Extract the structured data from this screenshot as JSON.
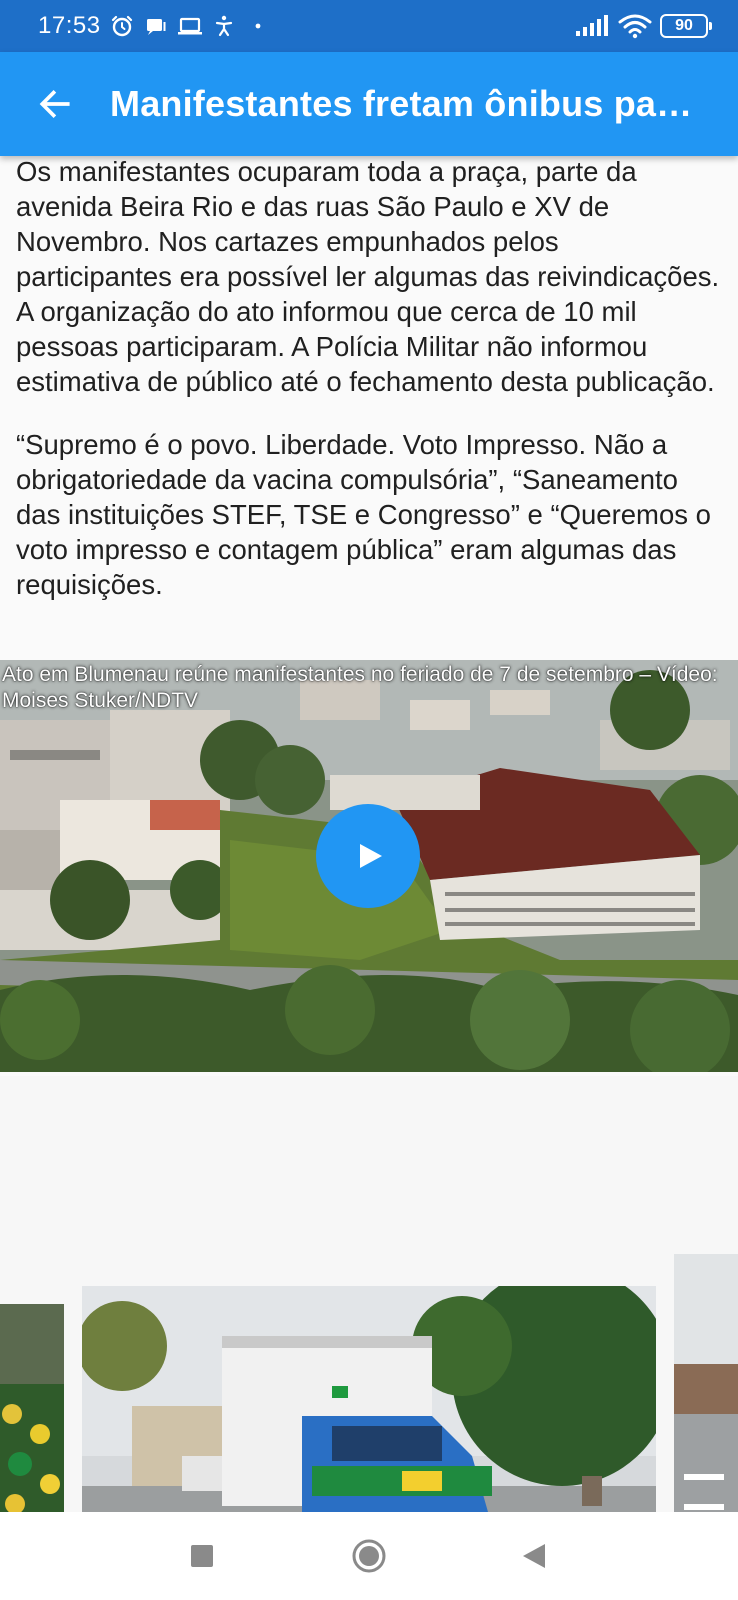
{
  "status_bar": {
    "time": "17:53",
    "battery": "90",
    "icons": [
      "alarm-icon",
      "message-icon",
      "laptop-icon",
      "accessibility-icon",
      "dot-icon",
      "signal-icon",
      "wifi-icon",
      "battery-icon"
    ]
  },
  "app_bar": {
    "title": "Manifestantes fretam ônibus pa…",
    "back_icon": "arrow-back-icon",
    "color": "#2196f3"
  },
  "article": {
    "paragraphs": [
      "Os manifestantes ocuparam toda a praça, parte da avenida Beira Rio e das ruas São Paulo e XV de Novembro. Nos cartazes empunhados pelos participantes era possível ler algumas das reivindicações. A organização do ato informou que cerca de 10 mil pessoas participaram. A Polícia Militar não informou estimativa de público até o fechamento desta publicação.",
      "“Supremo é o povo. Liberdade. Voto Impresso. Não a obrigatoriedade da vacina compulsória”, “Saneamento das instituições STEF, TSE e Congresso” e “Queremos o voto impresso e contagem pública” eram algumas das requisições."
    ]
  },
  "video": {
    "caption": "Ato em Blumenau reúne manifestantes no feriado de 7 de setembro – Vídeo: Moises Stuker/NDTV",
    "play_icon": "play-icon"
  },
  "gallery": {
    "slides": [
      "crowd-photo",
      "truck-photo",
      "street-photo"
    ]
  },
  "nav_bar": {
    "buttons": [
      "recents-square-icon",
      "home-circle-icon",
      "back-triangle-icon"
    ]
  }
}
